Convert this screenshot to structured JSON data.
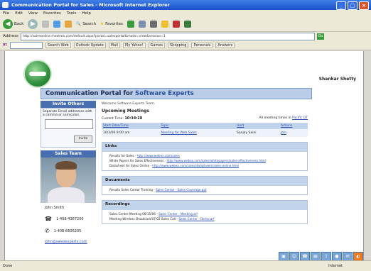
{
  "window": {
    "title": "Communication Portal for Sales - Microsoft Internet Explorer"
  },
  "menu": [
    "File",
    "Edit",
    "View",
    "Favorites",
    "Tools",
    "Help"
  ],
  "toolbar": {
    "back": "Back",
    "search": "Search",
    "favorites": "Favorites"
  },
  "address": {
    "label": "Address",
    "url": "http://salesonline.meetme.com/default.aspx?portal=salesportal&mode=view&session=1",
    "go": "Go"
  },
  "links_bar": {
    "search_button": "Search Web",
    "items": [
      "Outlook Update",
      "Mail",
      "My Yahoo!",
      "Games",
      "Shopping",
      "Personals",
      "Answers"
    ]
  },
  "page": {
    "user_name": "Shankar Shetty",
    "banner_prefix": "Communication Portal for ",
    "banner_accent": "Software Experts",
    "invite": {
      "title": "Invite Others",
      "text": "Separate Email addresses with a comma or semicolon.",
      "button": "Invite"
    },
    "sales_team": {
      "title": "Sales Team",
      "name": "John Smith",
      "phone1": "1-408-4367200",
      "phone2": "1-408-6606205",
      "email": "john@salesexperts.com"
    },
    "welcome": "Welcome Software Experts Team.",
    "upcoming_title": "Upcoming Meetings",
    "current_time_label": "Current Time:",
    "current_time": "10:34:28",
    "tz_note": "All meeting times in",
    "tz_link": "Pacific DT",
    "meetings": {
      "headers": [
        "Start Date/Time",
        "Topic",
        "Host",
        "Actions"
      ],
      "rows": [
        {
          "start": "10/3/06 9:00 am",
          "topic": "Meeting for Web Sales",
          "host": "Sanjay Saini",
          "action": "Join"
        }
      ]
    },
    "links": {
      "title": "Links",
      "items": [
        {
          "text": "Results for Sales - ",
          "link": "http://www.webex.com/sales"
        },
        {
          "text": "White Papers for Sales Effectiveness - ",
          "link": "http://www.webex.com/sales/whitepapers/sales-effectiveness.html"
        },
        {
          "text": "Datasheet for Sales Online - ",
          "link": "http://www.webex.com/sales/datasheets/sales-online.html"
        }
      ]
    },
    "documents": {
      "title": "Documents",
      "items": [
        {
          "text": "Results Sales Center Training - ",
          "link": "Sales Center - Sales Coverage.ppt"
        }
      ]
    },
    "recordings": {
      "title": "Recordings",
      "items": [
        {
          "text": "Sales Center Meeting 06/15/06 - ",
          "link": "Sales Center - Meeting.arf"
        },
        {
          "text": "Meeting Wireless Broadcast/07/02 Sales Call - ",
          "link": "Sales Center - Demo.arf"
        }
      ]
    }
  },
  "status": {
    "left": "Done",
    "right": "Internet"
  },
  "tray_icons": [
    "window-icon",
    "people-icon",
    "phone-icon",
    "doc-icon",
    "share-icon",
    "record-icon",
    "chat-icon",
    "webex-icon"
  ]
}
